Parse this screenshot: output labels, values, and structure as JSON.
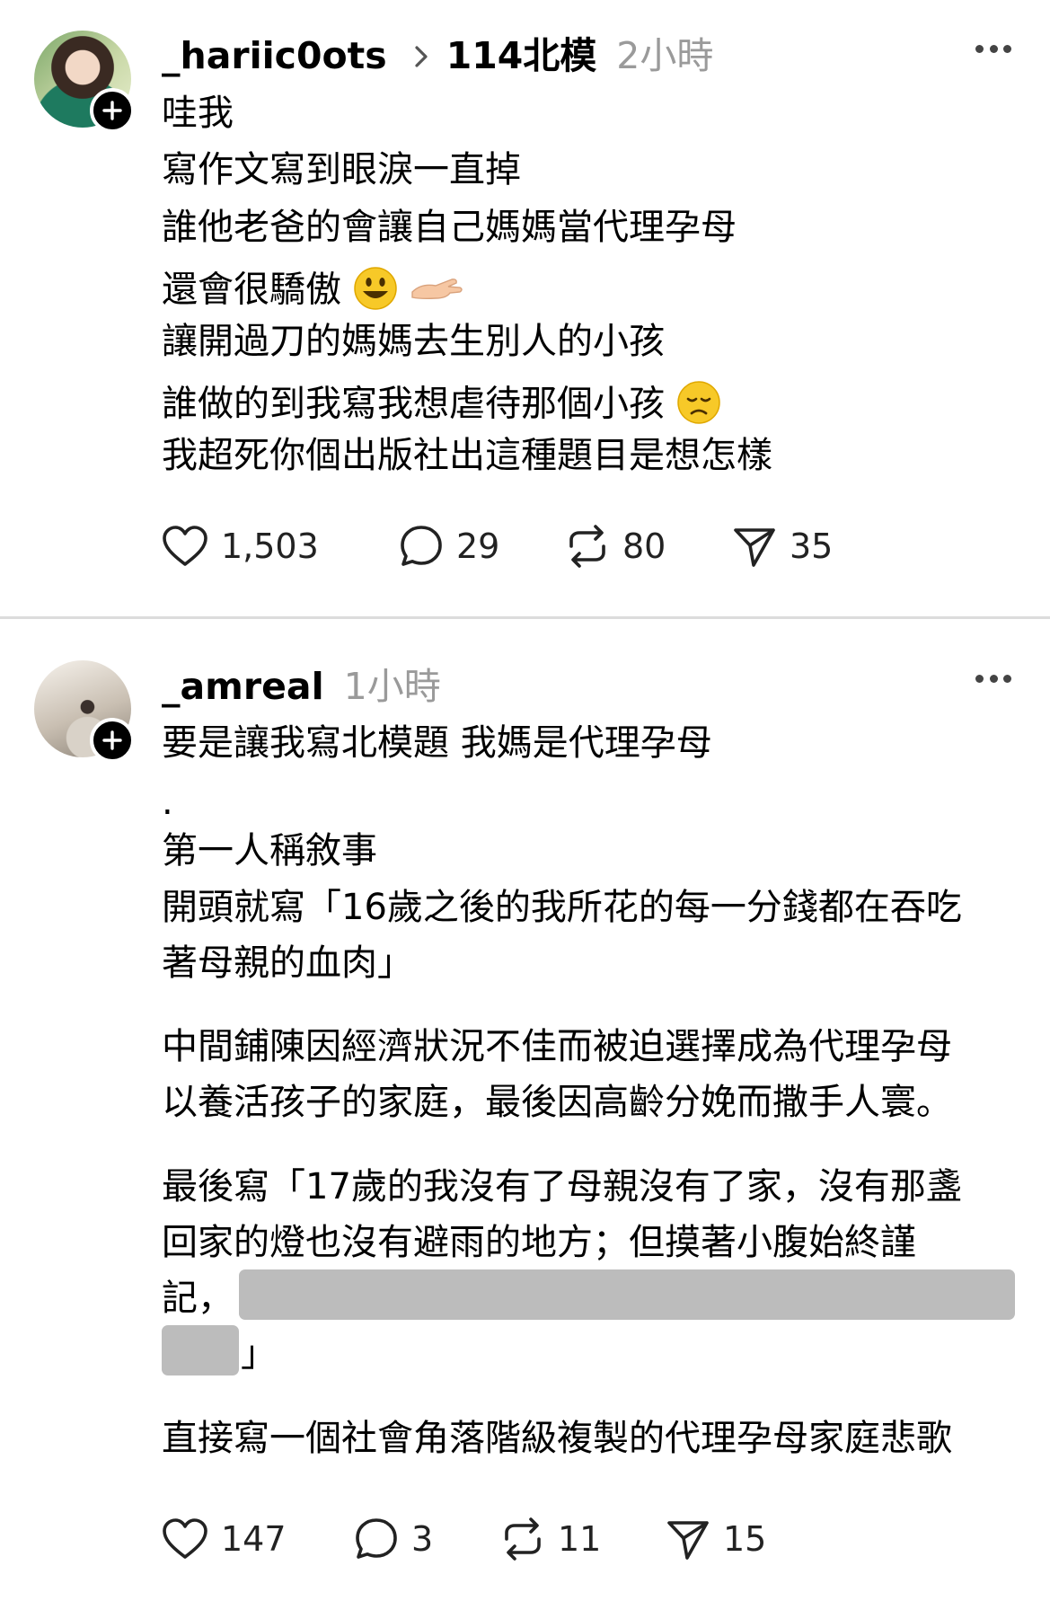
{
  "post1": {
    "username": "_hariic0ots",
    "topic": "114北模",
    "time": "2小時",
    "lines": [
      "哇我",
      "寫作文寫到眼淚一直掉",
      "誰他老爸的會讓自己媽媽當代理孕母",
      "還會很驕傲",
      "讓開過刀的媽媽去生別人的小孩",
      "誰做的到我寫我想虐待那個小孩",
      "我超死你個出版社出這種題目是想怎樣"
    ],
    "emoji_line4": [
      "grinning-face-emoji",
      "palm-up-hand-emoji"
    ],
    "emoji_line6": [
      "disappointed-face-emoji"
    ],
    "likes": "1,503",
    "comments": "29",
    "reposts": "80",
    "shares": "35"
  },
  "post2": {
    "username": "_amreal",
    "time": "1小時",
    "lines": [
      "要是讓我寫北模題 我媽是代理孕母",
      ".",
      "第一人稱敘事",
      "開頭就寫「16歲之後的我所花的每一分錢都在吞吃",
      "著母親的血肉」",
      "中間鋪陳因經濟狀況不佳而被迫選擇成為代理孕母",
      "以養活孩子的家庭，最後因高齡分娩而撒手人寰。",
      "最後寫「17歲的我沒有了母親沒有了家，沒有那盞",
      "回家的燈也沒有避雨的地方；但摸著小腹始終謹",
      "記，",
      "」",
      "直接寫一個社會角落階級複製的代理孕母家庭悲歌"
    ],
    "likes": "147",
    "comments": "3",
    "reposts": "11",
    "shares": "15"
  },
  "colors": {
    "time_gray": "#9a9a9a",
    "redaction": "#bcbcbc",
    "divider": "#dcdcdc"
  }
}
